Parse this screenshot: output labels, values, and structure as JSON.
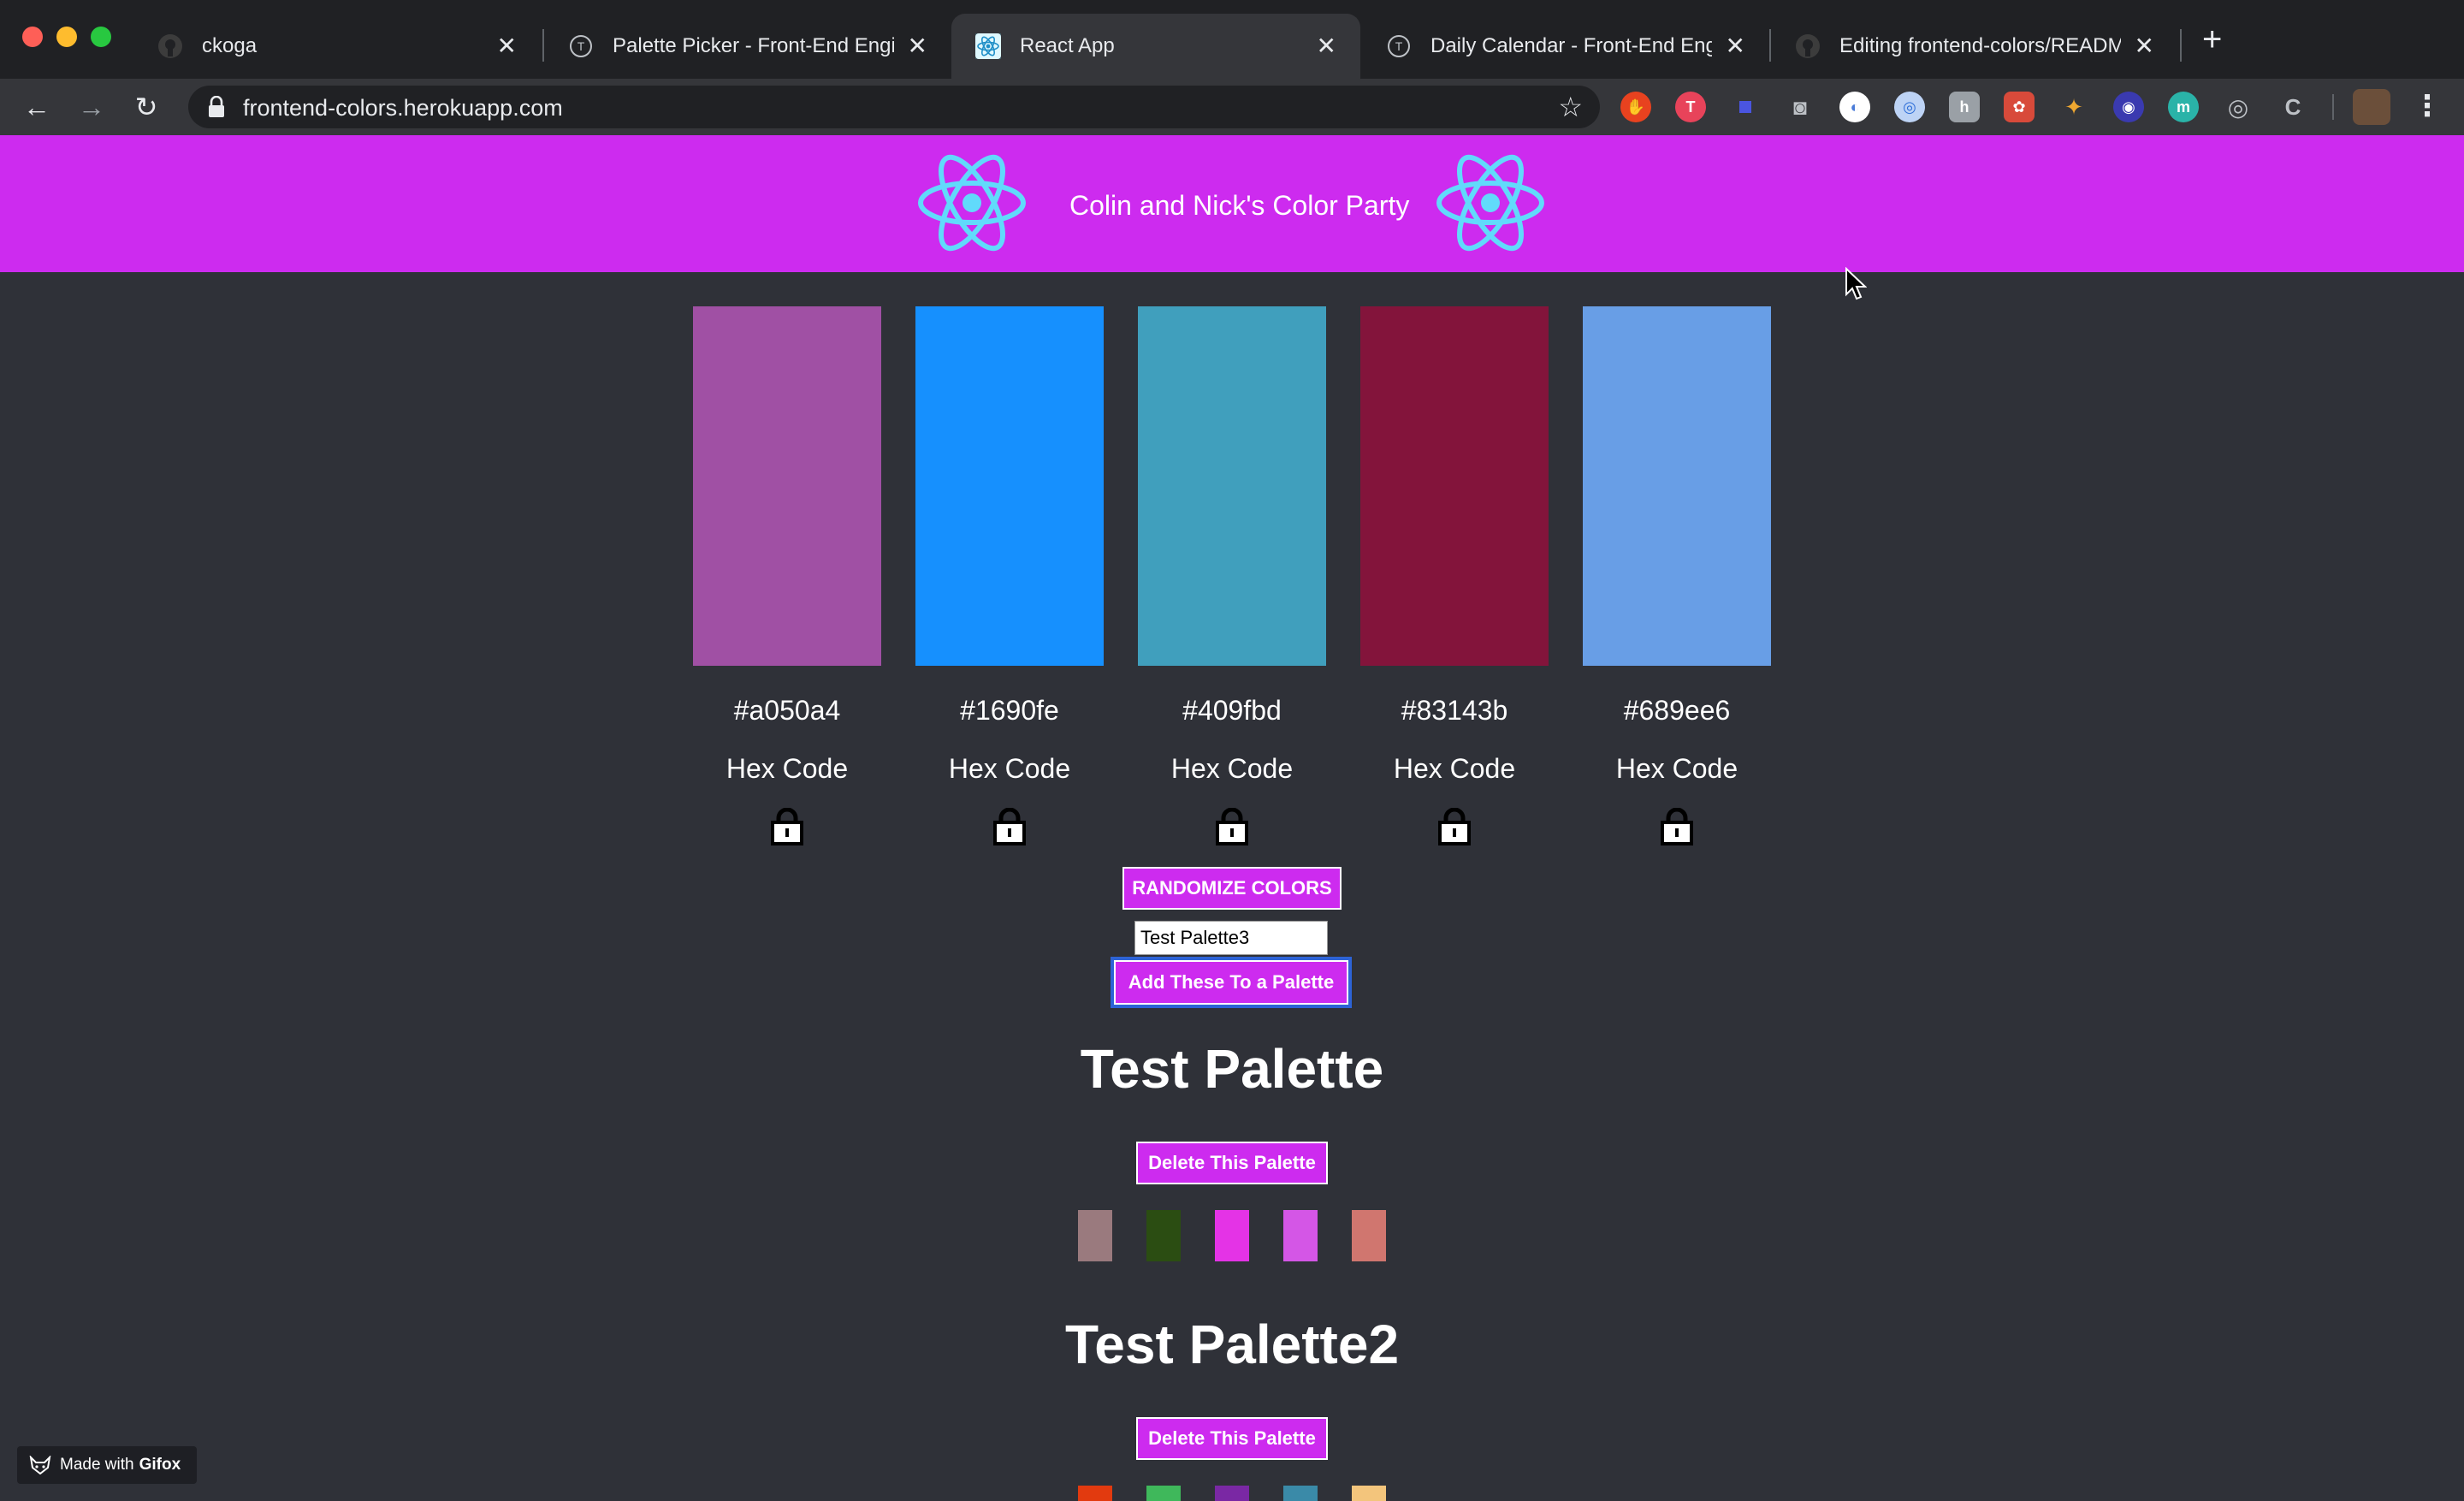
{
  "browser": {
    "tabs": [
      {
        "title": "ckoga",
        "active": false
      },
      {
        "title": "Palette Picker - Front-End Engine",
        "active": false
      },
      {
        "title": "React App",
        "active": true
      },
      {
        "title": "Daily Calendar - Front-End Engin",
        "active": false
      },
      {
        "title": "Editing frontend-colors/README",
        "active": false
      }
    ],
    "url": "frontend-colors.herokuapp.com"
  },
  "header": {
    "title": "Colin and Nick's Color Party"
  },
  "swatches": [
    {
      "color": "#a050a4",
      "hex": "#a050a4",
      "label": "Hex Code"
    },
    {
      "color": "#1690fe",
      "hex": "#1690fe",
      "label": "Hex Code"
    },
    {
      "color": "#409fbd",
      "hex": "#409fbd",
      "label": "Hex Code"
    },
    {
      "color": "#83143b",
      "hex": "#83143b",
      "label": "Hex Code"
    },
    {
      "color": "#689ee6",
      "hex": "#689ee6",
      "label": "Hex Code"
    }
  ],
  "controls": {
    "randomize_label": "RANDOMIZE COLORS",
    "palette_name_value": "Test Palette3",
    "add_label": "Add These To a Palette"
  },
  "palettes": [
    {
      "name": "Test Palette",
      "delete_label": "Delete This Palette",
      "colors": [
        "#9a7a7e",
        "#2b4d12",
        "#e433e6",
        "#d456e6",
        "#d0766f"
      ]
    },
    {
      "name": "Test Palette2",
      "delete_label": "Delete This Palette",
      "colors": [
        "#e23a0f",
        "#3fb85b",
        "#7a28a4",
        "#3a8aa8",
        "#f3c57c"
      ]
    }
  ],
  "badge": {
    "prefix": "Made with",
    "brand": "Gifox"
  },
  "colors": {
    "header_bg": "#cd2bef",
    "page_bg": "#2f3138",
    "react_blue": "#61dafb"
  }
}
